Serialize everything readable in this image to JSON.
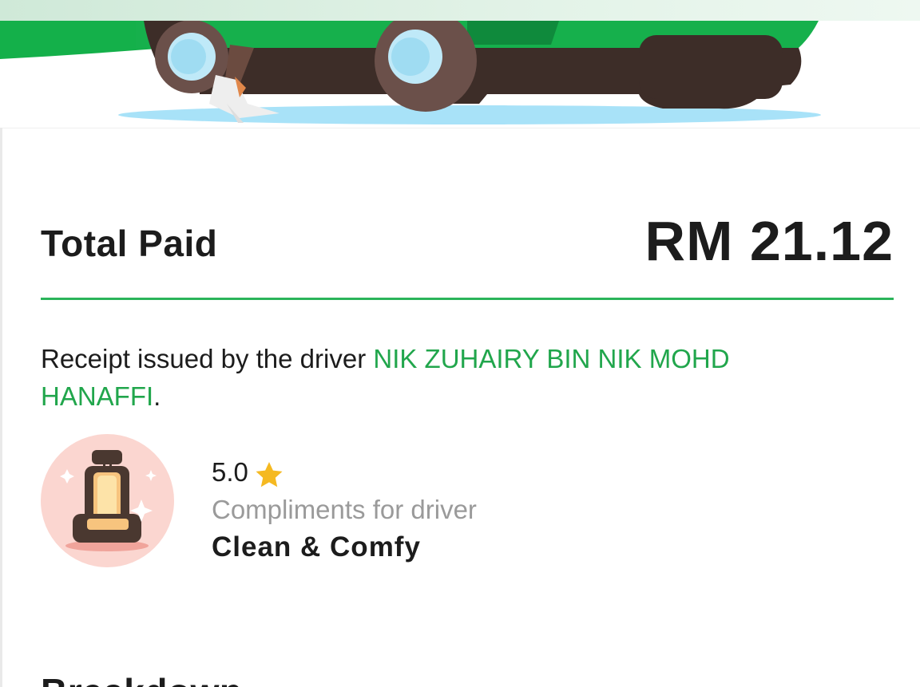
{
  "receipt": {
    "total_label": "Total Paid",
    "total_amount": "RM 21.12",
    "issued_prefix": "Receipt issued by the driver ",
    "driver_name": "NIK ZUHAIRY BIN NIK MOHD HANAFFI",
    "issued_suffix": "."
  },
  "rating": {
    "value": "5.0",
    "star_icon": "star-icon"
  },
  "compliment": {
    "label": "Compliments for driver",
    "value": "Clean & Comfy",
    "icon": "car-seat-icon"
  },
  "next_section": {
    "title": "Breakdown"
  },
  "colors": {
    "brand_green": "#21a64c",
    "divider_green": "#2bb45a",
    "star_yellow": "#f5b921",
    "muted_text": "#9a9a9a"
  }
}
